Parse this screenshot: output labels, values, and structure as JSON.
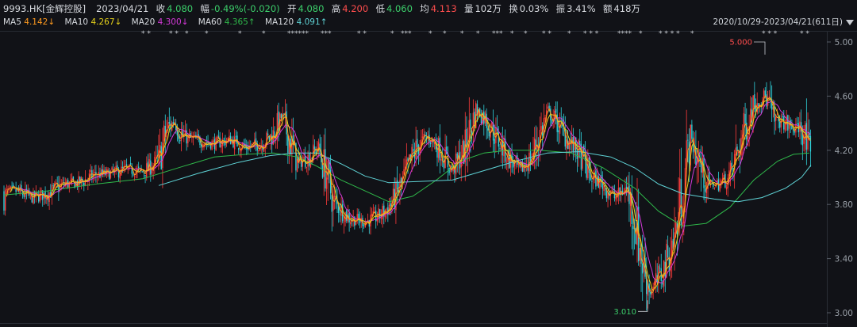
{
  "header": {
    "ticker": "9993.HK[金辉控股]",
    "date": "2023/04/21",
    "close_label": "收",
    "close": "4.080",
    "change_label": "幅",
    "change": "-0.49%(-0.020)",
    "open_label": "开",
    "open": "4.080",
    "high_label": "高",
    "high": "4.200",
    "low_label": "低",
    "low": "4.060",
    "avg_label": "均",
    "avg": "4.113",
    "volume_label": "量",
    "volume": "102万",
    "turnover_label": "换",
    "turnover": "0.03%",
    "amplitude_label": "振",
    "amplitude": "3.41%",
    "amount_label": "额",
    "amount": "418万"
  },
  "ma_legend": [
    {
      "name": "MA5",
      "value": "4.142↓",
      "color": "#ff9a1f"
    },
    {
      "name": "MA10",
      "value": "4.267↓",
      "color": "#e8d31a"
    },
    {
      "name": "MA20",
      "value": "4.300↓",
      "color": "#d43ad8"
    },
    {
      "name": "MA60",
      "value": "4.365↑",
      "color": "#2fb84a"
    },
    {
      "name": "MA120",
      "value": "4.091↑",
      "color": "#5fd3d6"
    }
  ],
  "range_label": "2020/10/29-2023/04/21(611日)",
  "chart_data": {
    "type": "candlestick",
    "period_days": 611,
    "ylim": [
      3.0,
      5.05
    ],
    "yticks": [
      "5.00",
      "4.60",
      "4.20",
      "3.80",
      "3.40",
      "3.00"
    ],
    "grid": false,
    "annotations": {
      "max": "5.000",
      "min": "3.010"
    },
    "colors": {
      "up": "#ff3b3b",
      "down": "#2fd0d9",
      "background": "#111217"
    },
    "price_path": [
      [
        0,
        3.88
      ],
      [
        20,
        3.9
      ],
      [
        40,
        3.85
      ],
      [
        60,
        3.88
      ],
      [
        80,
        3.95
      ],
      [
        100,
        3.96
      ],
      [
        120,
        4.02
      ],
      [
        140,
        4.03
      ],
      [
        160,
        4.06
      ],
      [
        180,
        4.04
      ],
      [
        200,
        4.12
      ],
      [
        210,
        4.35
      ],
      [
        220,
        4.42
      ],
      [
        230,
        4.3
      ],
      [
        250,
        4.27
      ],
      [
        270,
        4.25
      ],
      [
        290,
        4.28
      ],
      [
        310,
        4.22
      ],
      [
        330,
        4.25
      ],
      [
        345,
        4.32
      ],
      [
        355,
        4.45
      ],
      [
        365,
        4.28
      ],
      [
        375,
        4.1
      ],
      [
        390,
        4.15
      ],
      [
        400,
        4.22
      ],
      [
        410,
        4.05
      ],
      [
        420,
        3.82
      ],
      [
        440,
        3.7
      ],
      [
        460,
        3.67
      ],
      [
        480,
        3.72
      ],
      [
        495,
        3.82
      ],
      [
        510,
        4.0
      ],
      [
        525,
        4.22
      ],
      [
        540,
        4.3
      ],
      [
        555,
        4.2
      ],
      [
        570,
        4.05
      ],
      [
        585,
        4.2
      ],
      [
        600,
        4.5
      ],
      [
        610,
        4.45
      ],
      [
        625,
        4.3
      ],
      [
        640,
        4.15
      ],
      [
        655,
        4.05
      ],
      [
        670,
        4.15
      ],
      [
        690,
        4.48
      ],
      [
        700,
        4.42
      ],
      [
        715,
        4.28
      ],
      [
        730,
        4.18
      ],
      [
        745,
        4.0
      ],
      [
        760,
        3.95
      ],
      [
        775,
        3.85
      ],
      [
        790,
        3.92
      ],
      [
        800,
        3.7
      ],
      [
        810,
        3.35
      ],
      [
        820,
        3.15
      ],
      [
        835,
        3.3
      ],
      [
        850,
        3.55
      ],
      [
        860,
        3.9
      ],
      [
        870,
        4.3
      ],
      [
        880,
        4.12
      ],
      [
        890,
        3.95
      ],
      [
        905,
        3.95
      ],
      [
        920,
        4.0
      ],
      [
        935,
        4.3
      ],
      [
        950,
        4.55
      ],
      [
        965,
        4.6
      ],
      [
        975,
        4.42
      ],
      [
        990,
        4.4
      ],
      [
        1000,
        4.35
      ],
      [
        1010,
        4.38
      ],
      [
        1020,
        4.15
      ],
      [
        1022,
        4.08
      ]
    ],
    "moving_averages": [
      {
        "name": "MA60",
        "color": "#2fb84a",
        "points": [
          [
            5,
            3.87
          ],
          [
            60,
            3.9
          ],
          [
            120,
            3.95
          ],
          [
            180,
            3.99
          ],
          [
            230,
            4.08
          ],
          [
            270,
            4.15
          ],
          [
            310,
            4.17
          ],
          [
            345,
            4.18
          ],
          [
            375,
            4.15
          ],
          [
            400,
            4.08
          ],
          [
            430,
            3.98
          ],
          [
            460,
            3.9
          ],
          [
            490,
            3.82
          ],
          [
            520,
            3.86
          ],
          [
            550,
            3.98
          ],
          [
            580,
            4.12
          ],
          [
            610,
            4.18
          ],
          [
            640,
            4.2
          ],
          [
            680,
            4.2
          ],
          [
            720,
            4.18
          ],
          [
            760,
            4.07
          ],
          [
            800,
            3.92
          ],
          [
            830,
            3.75
          ],
          [
            860,
            3.64
          ],
          [
            890,
            3.66
          ],
          [
            920,
            3.78
          ],
          [
            950,
            3.98
          ],
          [
            980,
            4.12
          ],
          [
            1000,
            4.17
          ],
          [
            1020,
            4.18
          ]
        ]
      },
      {
        "name": "MA120",
        "color": "#5fd3d6",
        "points": [
          [
            200,
            3.94
          ],
          [
            250,
            4.03
          ],
          [
            300,
            4.11
          ],
          [
            340,
            4.16
          ],
          [
            370,
            4.18
          ],
          [
            400,
            4.18
          ],
          [
            430,
            4.1
          ],
          [
            460,
            4.01
          ],
          [
            490,
            3.96
          ],
          [
            530,
            3.97
          ],
          [
            570,
            3.98
          ],
          [
            610,
            4.05
          ],
          [
            650,
            4.12
          ],
          [
            690,
            4.18
          ],
          [
            730,
            4.19
          ],
          [
            770,
            4.15
          ],
          [
            800,
            4.07
          ],
          [
            830,
            3.95
          ],
          [
            860,
            3.88
          ],
          [
            900,
            3.84
          ],
          [
            930,
            3.82
          ],
          [
            960,
            3.85
          ],
          [
            990,
            3.92
          ],
          [
            1010,
            4.0
          ],
          [
            1022,
            4.09
          ]
        ]
      }
    ],
    "markers": [
      {
        "x": 178,
        "text": "* *"
      },
      {
        "x": 213,
        "text": "* *"
      },
      {
        "x": 233,
        "text": "*"
      },
      {
        "x": 258,
        "text": "*"
      },
      {
        "x": 300,
        "text": "*"
      },
      {
        "x": 330,
        "text": "*"
      },
      {
        "x": 362,
        "text": "******"
      },
      {
        "x": 404,
        "text": "***"
      },
      {
        "x": 450,
        "text": "* *"
      },
      {
        "x": 492,
        "text": "*"
      },
      {
        "x": 505,
        "text": "***"
      },
      {
        "x": 540,
        "text": "*"
      },
      {
        "x": 558,
        "text": "*"
      },
      {
        "x": 580,
        "text": "*"
      },
      {
        "x": 600,
        "text": "*"
      },
      {
        "x": 620,
        "text": "***"
      },
      {
        "x": 643,
        "text": "*"
      },
      {
        "x": 660,
        "text": "*"
      },
      {
        "x": 683,
        "text": "* *"
      },
      {
        "x": 715,
        "text": "*"
      },
      {
        "x": 735,
        "text": "* * *"
      },
      {
        "x": 778,
        "text": "****"
      },
      {
        "x": 805,
        "text": "*"
      },
      {
        "x": 830,
        "text": "* * * *"
      },
      {
        "x": 870,
        "text": "*"
      },
      {
        "x": 960,
        "text": "* * *"
      },
      {
        "x": 1008,
        "text": "* *"
      }
    ]
  }
}
